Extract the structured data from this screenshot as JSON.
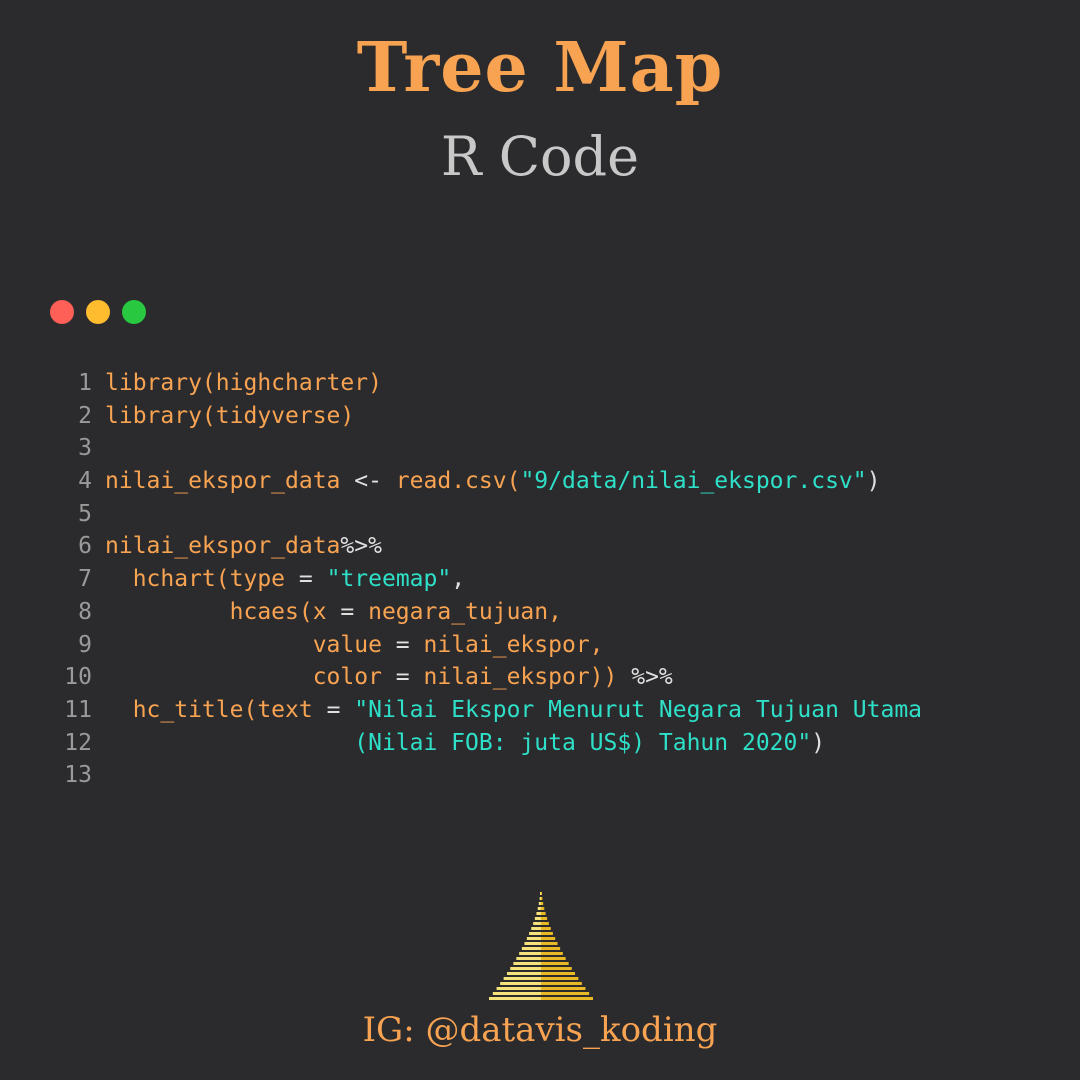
{
  "header": {
    "title": "Tree Map",
    "subtitle": "R Code"
  },
  "window_controls": [
    {
      "name": "close",
      "color": "#fe5f57"
    },
    {
      "name": "minimize",
      "color": "#febc2e"
    },
    {
      "name": "maximize",
      "color": "#28c840"
    }
  ],
  "colors": {
    "background": "#2b2b2d",
    "accent": "#f8a352",
    "string": "#2ee0c8",
    "line_number": "#9a9a9a",
    "operator": "#e0e0e0"
  },
  "code": {
    "lines": [
      {
        "num": "1",
        "tokens": [
          {
            "t": "library(highcharter)",
            "c": "fn"
          }
        ]
      },
      {
        "num": "2",
        "tokens": [
          {
            "t": "library(tidyverse)",
            "c": "fn"
          }
        ]
      },
      {
        "num": "3",
        "tokens": []
      },
      {
        "num": "4",
        "tokens": [
          {
            "t": "nilai_ekspor_data ",
            "c": "fn"
          },
          {
            "t": "<-",
            "c": "op"
          },
          {
            "t": " read.csv(",
            "c": "fn"
          },
          {
            "t": "\"9/data/nilai_ekspor.csv\"",
            "c": "str"
          },
          {
            "t": ")",
            "c": "op"
          }
        ]
      },
      {
        "num": "5",
        "tokens": []
      },
      {
        "num": "6",
        "tokens": [
          {
            "t": "nilai_ekspor_data",
            "c": "fn"
          },
          {
            "t": "%>%",
            "c": "op"
          }
        ]
      },
      {
        "num": "7",
        "tokens": [
          {
            "t": "  hchart(type ",
            "c": "fn"
          },
          {
            "t": "=",
            "c": "op"
          },
          {
            "t": " ",
            "c": "fn"
          },
          {
            "t": "\"treemap\"",
            "c": "str"
          },
          {
            "t": ",",
            "c": "op"
          }
        ]
      },
      {
        "num": "8",
        "tokens": [
          {
            "t": "         hcaes(x ",
            "c": "fn"
          },
          {
            "t": "=",
            "c": "op"
          },
          {
            "t": " negara_tujuan,",
            "c": "fn"
          }
        ]
      },
      {
        "num": "9",
        "tokens": [
          {
            "t": "               value ",
            "c": "fn"
          },
          {
            "t": "=",
            "c": "op"
          },
          {
            "t": " nilai_ekspor,",
            "c": "fn"
          }
        ]
      },
      {
        "num": "10",
        "tokens": [
          {
            "t": "               color ",
            "c": "fn"
          },
          {
            "t": "=",
            "c": "op"
          },
          {
            "t": " nilai_ekspor)) ",
            "c": "fn"
          },
          {
            "t": "%>%",
            "c": "op"
          }
        ]
      },
      {
        "num": "11",
        "tokens": [
          {
            "t": "  hc_title(text ",
            "c": "fn"
          },
          {
            "t": "=",
            "c": "op"
          },
          {
            "t": " ",
            "c": "fn"
          },
          {
            "t": "\"Nilai Ekspor Menurut Negara Tujuan Utama",
            "c": "str"
          }
        ]
      },
      {
        "num": "12",
        "tokens": [
          {
            "t": "                  ",
            "c": "fn"
          },
          {
            "t": "(Nilai FOB: juta US$) Tahun 2020\"",
            "c": "str"
          },
          {
            "t": ")",
            "c": "op"
          }
        ]
      },
      {
        "num": "13",
        "tokens": []
      }
    ]
  },
  "logo": {
    "icon": "stupa-bars-logo"
  },
  "footer": {
    "handle": "IG: @datavis_koding"
  }
}
